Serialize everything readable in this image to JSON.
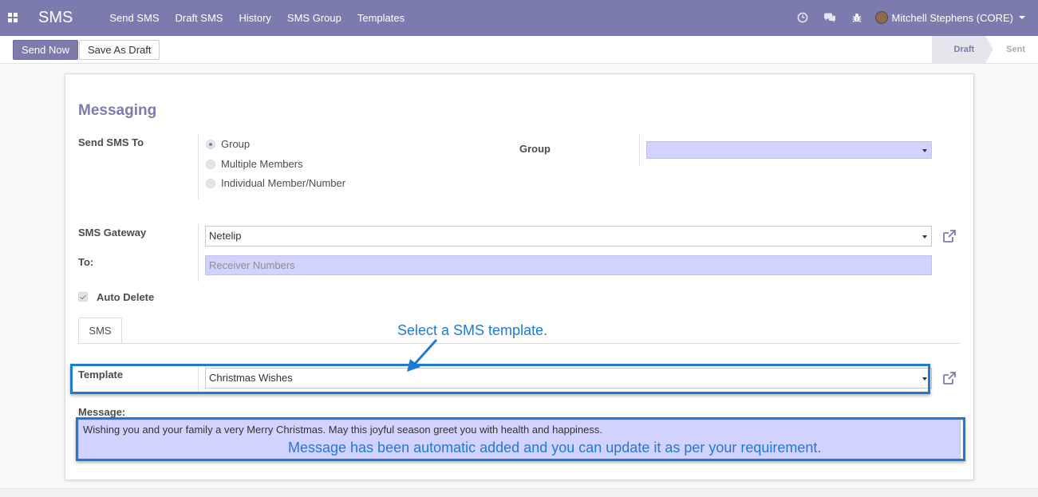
{
  "navbar": {
    "app_title": "SMS",
    "menu": [
      "Send SMS",
      "Draft SMS",
      "History",
      "SMS Group",
      "Templates"
    ],
    "user_name": "Mitchell Stephens (CORE)",
    "icons": [
      "apps-icon",
      "clock-icon",
      "chat-icon",
      "bug-icon"
    ]
  },
  "control": {
    "send_now": "Send Now",
    "save_draft": "Save As Draft",
    "statuses": [
      "Draft",
      "Sent"
    ],
    "active_status": "Draft"
  },
  "form": {
    "title": "Messaging",
    "send_to_label": "Send SMS To",
    "send_to_options": [
      "Group",
      "Multiple Members",
      "Individual Member/Number"
    ],
    "send_to_selected": "Group",
    "group_label": "Group",
    "group_value": "",
    "gateway_label": "SMS Gateway",
    "gateway_value": "Netelip",
    "to_label": "To:",
    "to_placeholder": "Receiver Numbers",
    "auto_delete_label": "Auto Delete",
    "auto_delete_checked": true,
    "tab_label": "SMS",
    "template_label": "Template",
    "template_value": "Christmas Wishes",
    "message_label": "Message:",
    "message_value": "Wishing you and your family a very Merry Christmas. May this joyful season greet you with health and happiness."
  },
  "annotations": {
    "select_template": "Select a SMS template.",
    "message_note": "Message has been automatic added and you can update it as per your requirement."
  },
  "colors": {
    "brand": "#7c7bad",
    "required_field": "#d2d2ff",
    "annotation": "#1f7ad1"
  }
}
